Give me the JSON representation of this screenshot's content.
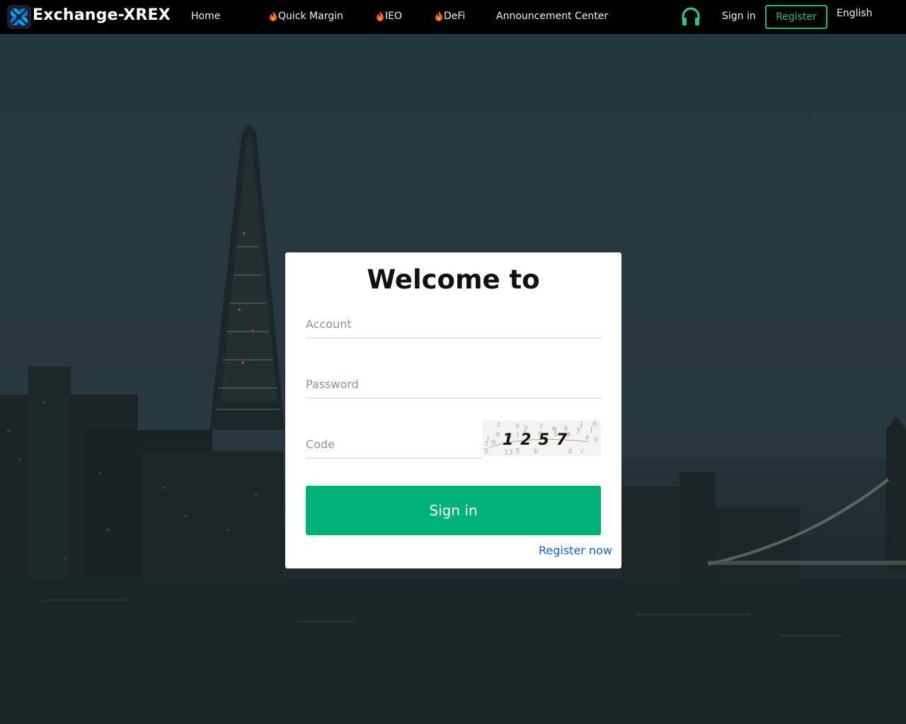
{
  "nav": {
    "brand": "Exchange-XREX",
    "links": [
      "Home",
      "Quick Margin",
      "IEO",
      "DeFi",
      "Announcement Center"
    ],
    "signin_label": "Sign in",
    "register_label": "Register",
    "language": "English"
  },
  "login": {
    "title": "Welcome to",
    "account_placeholder": "Account",
    "password_placeholder": "Password",
    "code_placeholder": "Code",
    "captcha_text": "1257",
    "signin_label": "Sign in",
    "register_now_label": "Register now"
  },
  "colors": {
    "accent": "#00b277",
    "register_border": "#1fb38a",
    "link": "#1565d8",
    "support_icon": "#2fc28f"
  }
}
